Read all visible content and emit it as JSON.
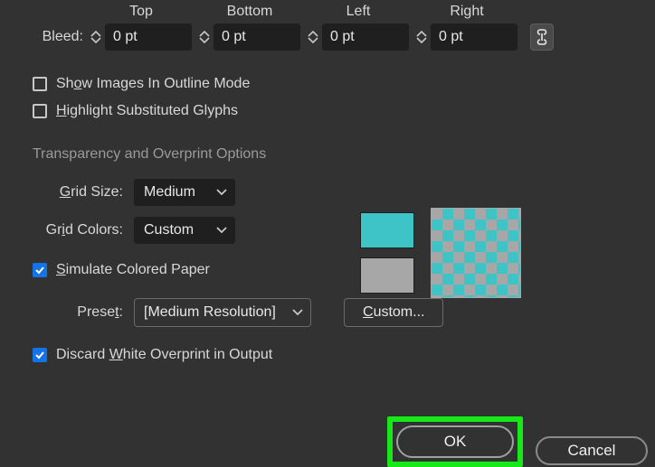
{
  "bleed": {
    "label": "Bleed:",
    "columns": {
      "top": {
        "label": "Top",
        "value": "0 pt"
      },
      "bottom": {
        "label": "Bottom",
        "value": "0 pt"
      },
      "left": {
        "label": "Left",
        "value": "0 pt"
      },
      "right": {
        "label": "Right",
        "value": "0 pt"
      }
    }
  },
  "checkboxes": {
    "show_images_outline": {
      "checked": false,
      "label_pre": "Sh",
      "label_ul": "o",
      "label_post": "w Images In Outline Mode"
    },
    "highlight_sub_glyphs": {
      "checked": false,
      "label_pre": "",
      "label_ul": "H",
      "label_post": "ighlight Substituted Glyphs"
    },
    "simulate_colored_paper": {
      "checked": true,
      "label_pre": "",
      "label_ul": "S",
      "label_post": "imulate Colored Paper"
    },
    "discard_white_overprint": {
      "checked": true,
      "label_pre": "Discard ",
      "label_ul": "W",
      "label_post": "hite Overprint in Output"
    }
  },
  "section_title": "Transparency and Overprint Options",
  "grid_size": {
    "label_pre": "",
    "label_ul": "G",
    "label_post": "rid Size:",
    "value": "Medium"
  },
  "grid_colors": {
    "label_pre": "Gr",
    "label_ul": "i",
    "label_post": "d Colors:",
    "value": "Custom"
  },
  "preset": {
    "label_pre": "Prese",
    "label_ul": "t",
    "label_post": ":",
    "value": "[Medium Resolution]"
  },
  "custom_button": {
    "label_pre": "",
    "label_ul": "C",
    "label_post": "ustom..."
  },
  "swatches": {
    "primary": "#3ec3c7",
    "secondary": "#a7a7a7"
  },
  "footer": {
    "ok": "OK",
    "cancel": "Cancel"
  }
}
